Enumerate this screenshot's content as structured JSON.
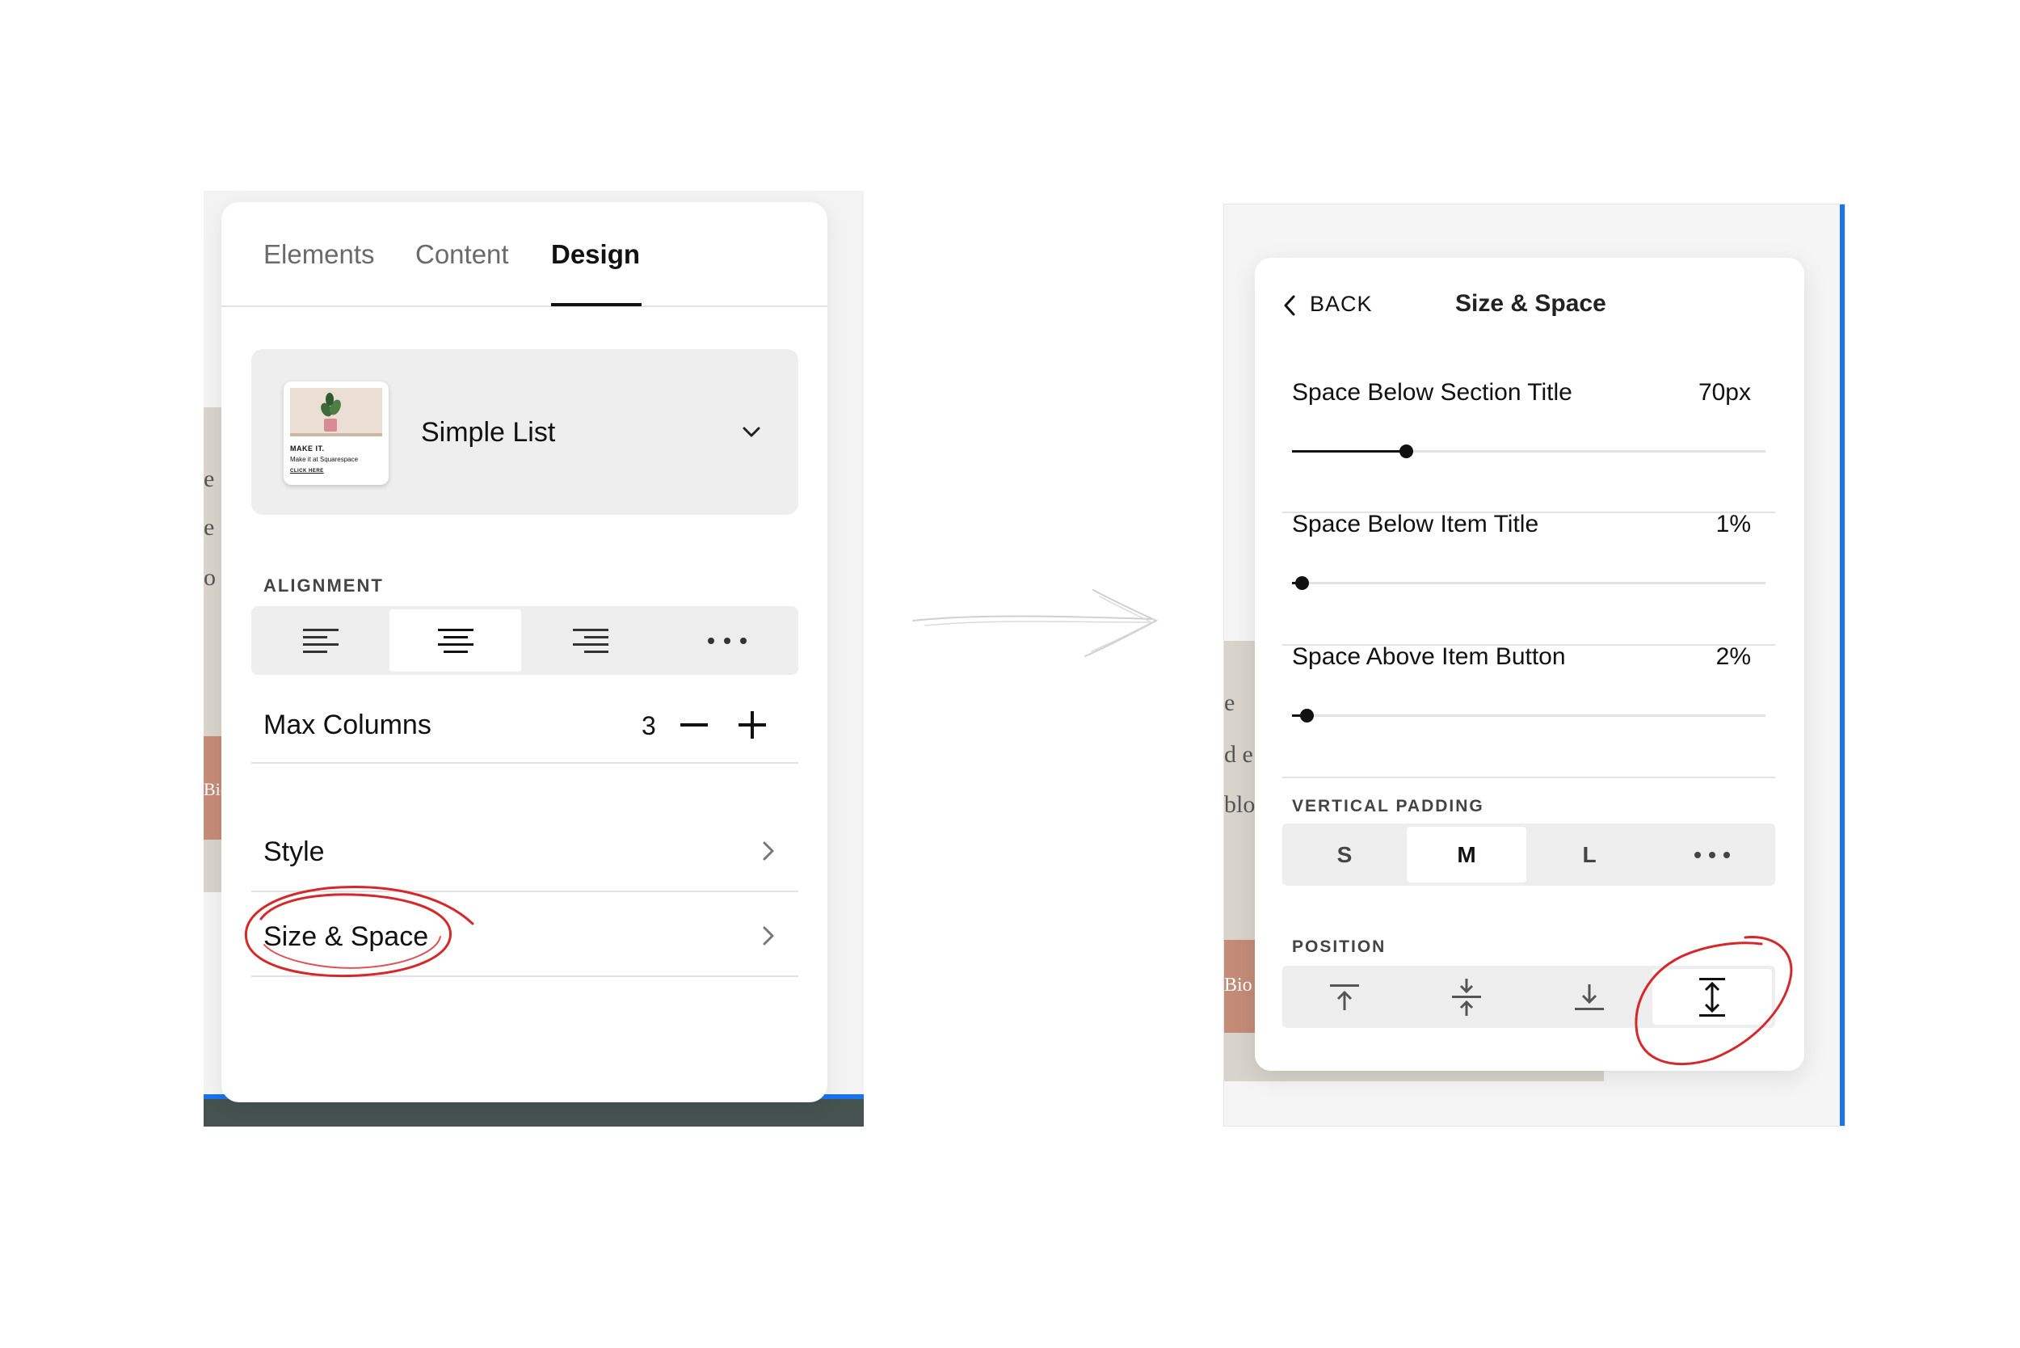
{
  "colors": {
    "accent_blue": "#1a73e8",
    "annotation_red": "#d62828",
    "terracotta": "#c48b78",
    "beige": "#d8d4cc",
    "footer_dark": "#46524f"
  },
  "left": {
    "tabs": [
      {
        "label": "Elements",
        "active": false
      },
      {
        "label": "Content",
        "active": false
      },
      {
        "label": "Design",
        "active": true
      }
    ],
    "layout": {
      "name": "Simple List",
      "thumb": {
        "line1": "MAKE IT.",
        "line2": "Make it at Squarespace",
        "line3": "CLICK HERE"
      }
    },
    "alignment": {
      "label": "ALIGNMENT",
      "options": [
        "align-left-icon",
        "align-center-icon",
        "align-right-icon",
        "more-icon"
      ],
      "selected": "align-center-icon"
    },
    "max_columns": {
      "label": "Max Columns",
      "value": "3"
    },
    "rows": [
      {
        "label": "Style"
      },
      {
        "label": "Size & Space",
        "highlighted": true
      }
    ],
    "bg_text": [
      "e",
      "e",
      "o",
      "Bio"
    ]
  },
  "right": {
    "back_label": "BACK",
    "title": "Size & Space",
    "sliders": [
      {
        "label": "Space Below Section Title",
        "value": "70px",
        "level": 0.24
      },
      {
        "label": "Space Below Item Title",
        "value": "1%",
        "level": 0.02
      },
      {
        "label": "Space Above Item Button",
        "value": "2%",
        "level": 0.03
      }
    ],
    "vertical_padding": {
      "label": "VERTICAL PADDING",
      "options": [
        "S",
        "M",
        "L",
        "more-icon"
      ],
      "selected": "M"
    },
    "position": {
      "label": "POSITION",
      "options": [
        "align-top-icon",
        "align-middle-icon",
        "align-bottom-icon",
        "stretch-vertical-icon"
      ],
      "selected": "stretch-vertical-icon"
    },
    "bg_text": [
      "e",
      "d e",
      "blo",
      "Bio"
    ]
  }
}
